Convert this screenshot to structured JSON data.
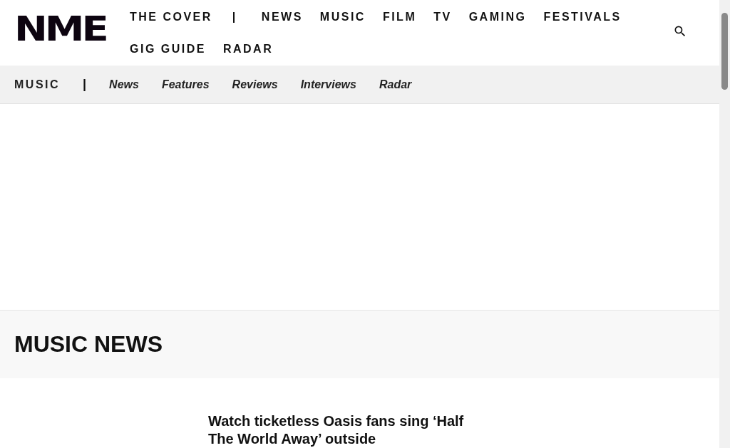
{
  "logo": "NME",
  "main_nav": [
    {
      "label": "THE COVER",
      "kind": "link"
    },
    {
      "label": "|",
      "kind": "separator"
    },
    {
      "label": "NEWS",
      "kind": "link"
    },
    {
      "label": "MUSIC",
      "kind": "link"
    },
    {
      "label": "FILM",
      "kind": "link"
    },
    {
      "label": "TV",
      "kind": "link"
    },
    {
      "label": "GAMING",
      "kind": "link"
    },
    {
      "label": "FESTIVALS",
      "kind": "link"
    },
    {
      "label": "GIG GUIDE",
      "kind": "link"
    },
    {
      "label": "RADAR",
      "kind": "link"
    }
  ],
  "sub_nav": {
    "section": "MUSIC",
    "separator": "|",
    "items": [
      "News",
      "Features",
      "Reviews",
      "Interviews",
      "Radar"
    ]
  },
  "page_title": "MUSIC NEWS",
  "articles": [
    {
      "headline": "Watch ticketless Oasis fans sing ‘Half The World Away’ outside"
    }
  ]
}
